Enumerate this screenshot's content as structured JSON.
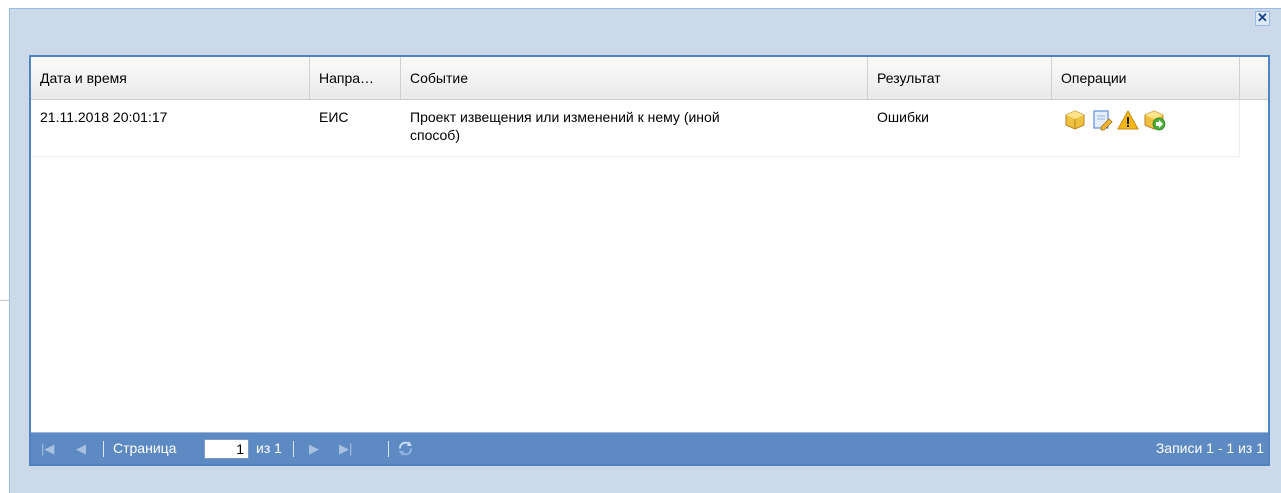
{
  "columns": [
    "Дата и время",
    "Напра…",
    "Событие",
    "Результат",
    "Операции"
  ],
  "rows": [
    {
      "datetime": "21.11.2018 20:01:17",
      "direction": "ЕИС",
      "event_line1": "Проект извещения или изменений к нему (иной",
      "event_line2": "способ)",
      "result": "Ошибки",
      "operations": [
        "package-icon",
        "document-edit-icon",
        "warning-icon",
        "package-forward-icon"
      ]
    }
  ],
  "pager": {
    "page_label": "Страница",
    "page_value": "1",
    "of_label": "из 1",
    "records": "Записи 1 - 1 из 1"
  },
  "close_symbol": "✕",
  "colors": {
    "toolbar": "#5d8ac2",
    "panel_border": "#4f84c2",
    "window_bg": "#ccd9e8"
  }
}
